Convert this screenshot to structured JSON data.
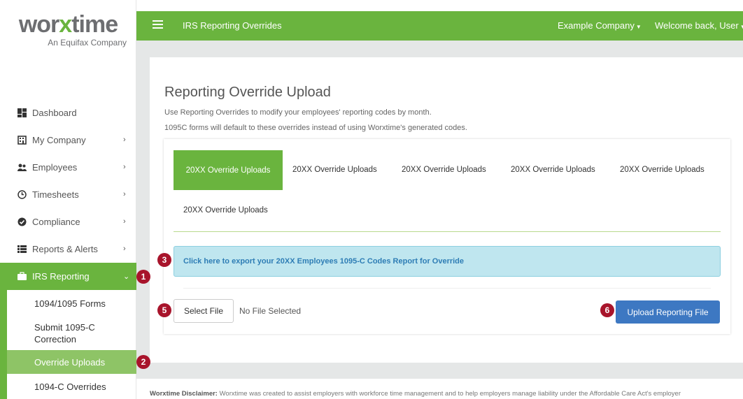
{
  "brand": {
    "logo_part1": "wor",
    "logo_x": "x",
    "logo_part2": "time",
    "subtitle": "An Equifax Company",
    "accent_color": "#6ab43e"
  },
  "sidebar": {
    "items": [
      {
        "label": "Dashboard",
        "icon": "dashboard-icon"
      },
      {
        "label": "My Company",
        "icon": "building-icon",
        "has_children": true
      },
      {
        "label": "Employees",
        "icon": "users-icon",
        "has_children": true
      },
      {
        "label": "Timesheets",
        "icon": "clock-icon",
        "has_children": true
      },
      {
        "label": "Compliance",
        "icon": "check-circle-icon",
        "has_children": true
      },
      {
        "label": "Reports & Alerts",
        "icon": "list-icon",
        "has_children": true
      },
      {
        "label": "IRS Reporting",
        "icon": "briefcase-icon",
        "expanded": true,
        "active": true
      }
    ],
    "sub_items": [
      {
        "label": "1094/1095 Forms"
      },
      {
        "label": "Submit 1095-C Correction"
      },
      {
        "label": "Override Uploads",
        "active": true
      },
      {
        "label": "1094-C Overrides"
      }
    ]
  },
  "header": {
    "title": "IRS Reporting Overrides",
    "company": "Example Company",
    "welcome": "Welcome back, User"
  },
  "main": {
    "heading": "Reporting Override Upload",
    "description_line1": "Use Reporting Overrides to modify your employees' reporting codes by month.",
    "description_line2": "1095C forms will default to these overrides instead of using Worxtime's generated codes.",
    "tabs": [
      {
        "label": "20XX Override Uploads",
        "active": true
      },
      {
        "label": "20XX Override Uploads"
      },
      {
        "label": "20XX Override Uploads"
      },
      {
        "label": "20XX Override Uploads"
      },
      {
        "label": "20XX Override Uploads"
      },
      {
        "label": "20XX Override Uploads"
      }
    ],
    "export_link": "Click here to export your 20XX Employees 1095-C Codes Report for Override",
    "select_file_label": "Select File",
    "no_file_text": "No File Selected",
    "upload_label": "Upload Reporting File"
  },
  "markers": [
    "1",
    "2",
    "3",
    "5",
    "6"
  ],
  "footer": {
    "disclaimer_label": "Worxtime Disclaimer:",
    "disclaimer_text": "Worxtime was created to assist employers with workforce time management and to help employers manage liability under the Affordable Care Act's employer"
  }
}
